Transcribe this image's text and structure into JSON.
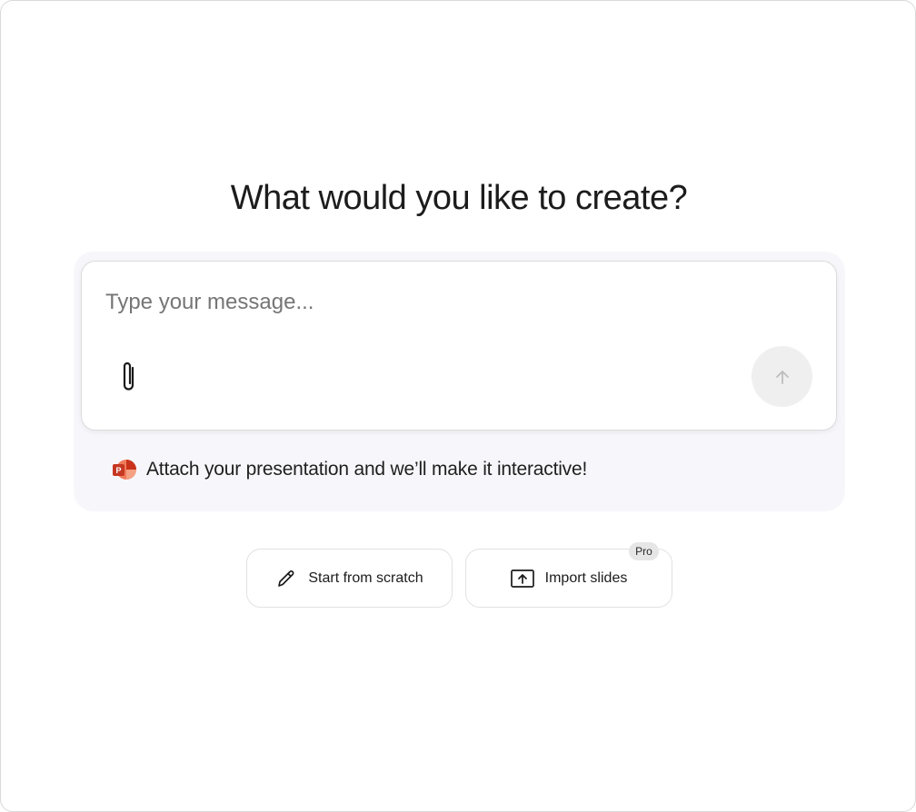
{
  "heading": "What would you like to create?",
  "composer": {
    "placeholder": "Type your message...",
    "value": "",
    "attach_icon": "paperclip-icon",
    "send_icon": "arrow-up-icon"
  },
  "hint": {
    "icon": "powerpoint-icon",
    "text": "Attach your presentation and we’ll make it interactive!"
  },
  "actions": {
    "start_from_scratch": {
      "label": "Start from scratch",
      "icon": "pencil-icon"
    },
    "import_slides": {
      "label": "Import slides",
      "icon": "upload-icon",
      "badge": "Pro"
    }
  },
  "colors": {
    "panel_bg": "#f7f7fb",
    "send_button_bg": "#f0efef",
    "badge_bg": "#e6e6e6",
    "ppt_red": "#d9472b",
    "ppt_orange": "#f07b5a"
  }
}
